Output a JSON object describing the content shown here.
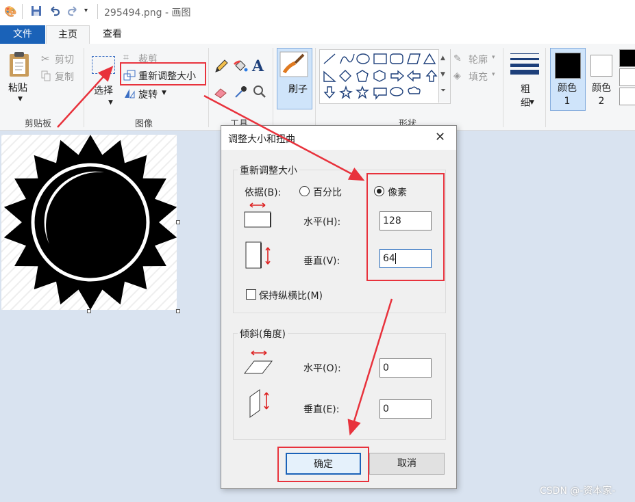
{
  "window": {
    "filename": "295494.png",
    "app_name": "画图",
    "separator": " - "
  },
  "tabs": {
    "file": "文件",
    "home": "主页",
    "view": "查看"
  },
  "ribbon": {
    "clipboard": {
      "paste": "粘贴",
      "cut": "剪切",
      "copy": "复制",
      "label": "剪贴板"
    },
    "image": {
      "select": "选择",
      "crop": "裁剪",
      "resize": "重新调整大小",
      "rotate": "旋转",
      "label": "图像"
    },
    "tools": {
      "label": "工具",
      "text_glyph": "A"
    },
    "brushes": {
      "label": "刷子"
    },
    "shapes": {
      "outline": "轮廓",
      "fill": "填充",
      "label": "形状"
    },
    "size": {
      "label": "粗细"
    },
    "colors": {
      "color1": "颜色 1",
      "color2": "颜色 2"
    }
  },
  "dialog": {
    "title": "调整大小和扭曲",
    "resize_section": "重新调整大小",
    "by_label": "依据(B):",
    "percent": "百分比",
    "pixels": "像素",
    "horizontal": "水平(H):",
    "horizontal_value": "128",
    "vertical": "垂直(V):",
    "vertical_value": "64",
    "keep_aspect": "保持纵横比(M)",
    "skew_section": "倾斜(角度)",
    "skew_horizontal": "水平(O):",
    "skew_horizontal_value": "0",
    "skew_vertical": "垂直(E):",
    "skew_vertical_value": "0",
    "ok": "确定",
    "cancel": "取消"
  },
  "watermark": "CSDN @-资本家-",
  "colors": {
    "accent": "#1a62b8",
    "annotation_red": "#e8323c"
  }
}
